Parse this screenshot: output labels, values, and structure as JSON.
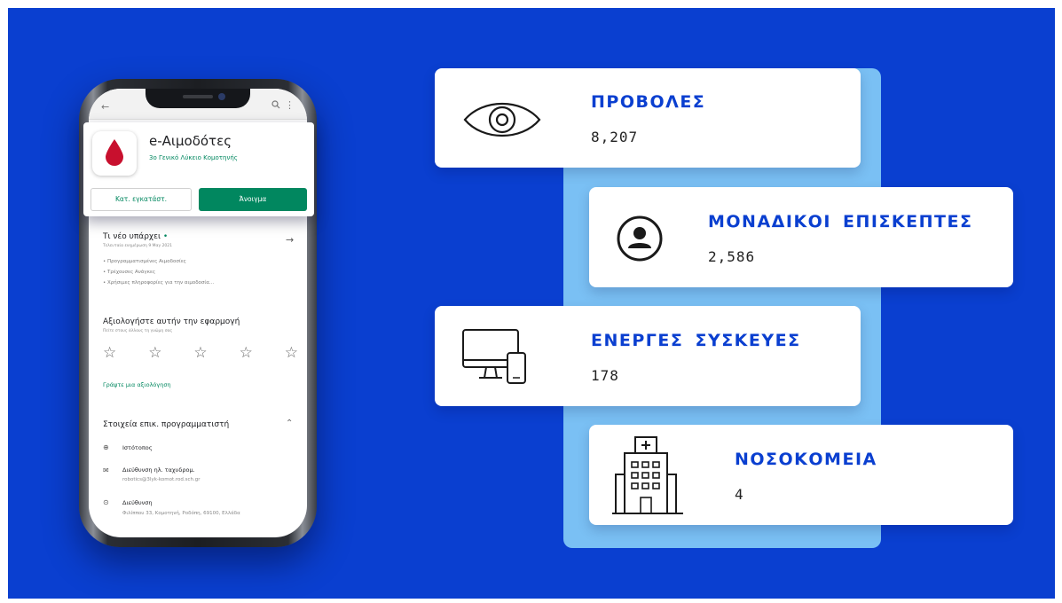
{
  "phone": {
    "browser": {
      "back_icon": "arrow-left-icon",
      "search_icon": "search-icon",
      "more_icon": "more-vert-icon"
    },
    "app": {
      "icon": "blood-drop-icon",
      "name": "e-Αιμοδότες",
      "developer": "3ο Γενικό Λύκειο Κομοτηνής",
      "installed_button": "Κατ. εγκατάστ.",
      "open_button": "Άνοιγμα",
      "brand_color": "#01875f"
    },
    "whats_new": {
      "title": "Τι νέο υπάρχει",
      "updated": "Τελευταία ενημέρωση 9 Μαγ 2021",
      "items": [
        "• Προγραμματισμένες Αιμοδοσίες",
        "• Τρέχουσες Ανάγκες",
        "• Χρήσιμες πληροφορίες για την αιμοδοσία..."
      ]
    },
    "rating": {
      "title": "Αξιολογήστε αυτήν την εφαρμογή",
      "subtitle": "Πείτε στους άλλους τη γνώμη σας",
      "stars": [
        "☆",
        "☆",
        "☆",
        "☆",
        "☆"
      ],
      "write_review": "Γράψτε μια αξιολόγηση"
    },
    "developer_contact": {
      "title": "Στοιχεία επικ. προγραμματιστή",
      "rows": [
        {
          "icon": "globe-icon",
          "glyph": "⊕",
          "label": "Ιστότοπος",
          "value": ""
        },
        {
          "icon": "email-icon",
          "glyph": "✉",
          "label": "Διεύθυνση ηλ. ταχυδρομ.",
          "value": "robotics@3lyk-komot.rod.sch.gr"
        },
        {
          "icon": "location-icon",
          "glyph": "⊙",
          "label": "Διεύθυνση",
          "value": "Φιλίππου 33, Κομοτηνή, Ροδόπη, 69100, Ελλάδα"
        }
      ]
    }
  },
  "stats": [
    {
      "key": "views",
      "icon": "eye-icon",
      "label": "ΠΡΟΒΟΛΕΣ",
      "value": "8,207"
    },
    {
      "key": "unique",
      "icon": "user-icon",
      "label": "ΜΟΝΑΔΙΚΟΙ ΕΠΙΣΚΕΠΤΕΣ",
      "value": "2,586"
    },
    {
      "key": "devices",
      "icon": "devices-icon",
      "label": "ΕΝΕΡΓΕΣ ΣΥΣΚΕΥΕΣ",
      "value": "178"
    },
    {
      "key": "hospitals",
      "icon": "hospital-icon",
      "label": "ΝΟΣΟΚΟΜΕΙΑ",
      "value": "4"
    }
  ],
  "colors": {
    "background": "#0a3fd0",
    "accent_bar": "#7ac0f4",
    "label": "#0a3fd0"
  }
}
